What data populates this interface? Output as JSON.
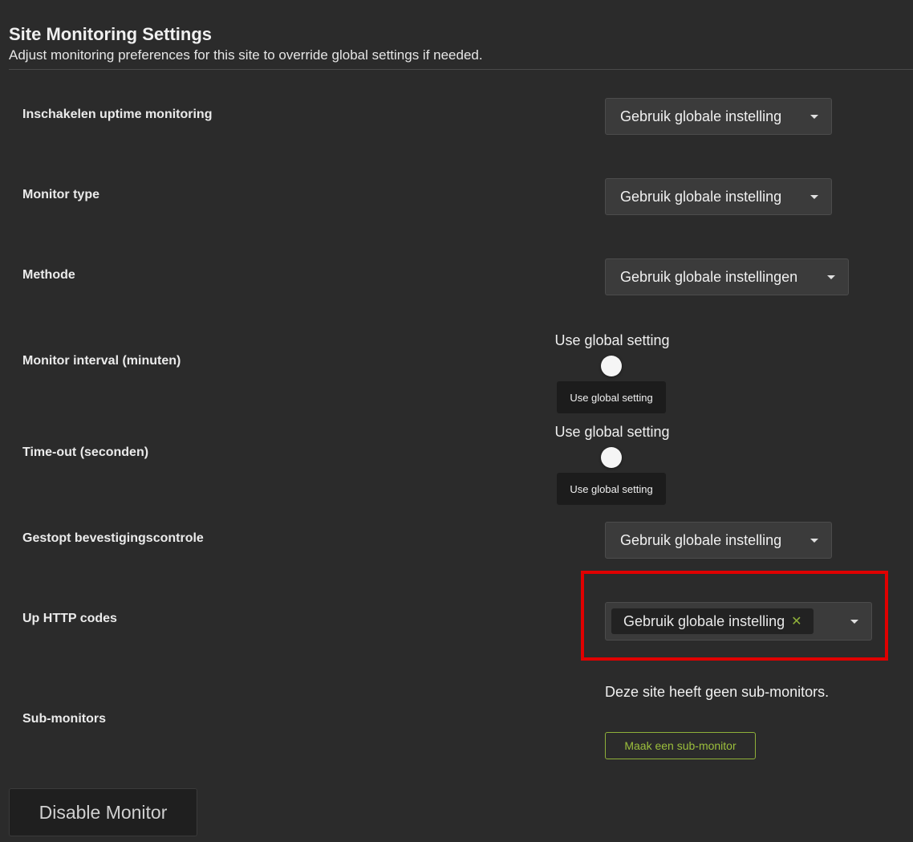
{
  "header": {
    "title": "Site Monitoring Settings",
    "subtitle": "Adjust monitoring preferences for this site to override global settings if needed."
  },
  "rows": {
    "uptime": {
      "label": "Inschakelen uptime monitoring",
      "value": "Gebruik globale instelling"
    },
    "monitor_type": {
      "label": "Monitor type",
      "value": "Gebruik globale instelling"
    },
    "method": {
      "label": "Methode",
      "value": "Gebruik globale instellingen"
    },
    "interval": {
      "label": "Monitor interval (minuten)",
      "toggle_label": "Use global setting",
      "tooltip": "Use global setting"
    },
    "timeout": {
      "label": "Time-out (seconden)",
      "toggle_label": "Use global setting",
      "tooltip": "Use global setting"
    },
    "paused_check": {
      "label": "Gestopt bevestigingscontrole",
      "value": "Gebruik globale instelling"
    },
    "http_codes": {
      "label": "Up HTTP codes",
      "chip": "Gebruik globale instelling",
      "chip_remove": "✕"
    },
    "sub_monitors": {
      "label": "Sub-monitors",
      "empty_text": "Deze site heeft geen sub-monitors.",
      "create_button": "Maak een sub-monitor"
    }
  },
  "footer": {
    "disable_button": "Disable Monitor"
  },
  "colors": {
    "background": "#2b2b2b",
    "accent": "#8fb03a",
    "highlight": "#e00000"
  }
}
